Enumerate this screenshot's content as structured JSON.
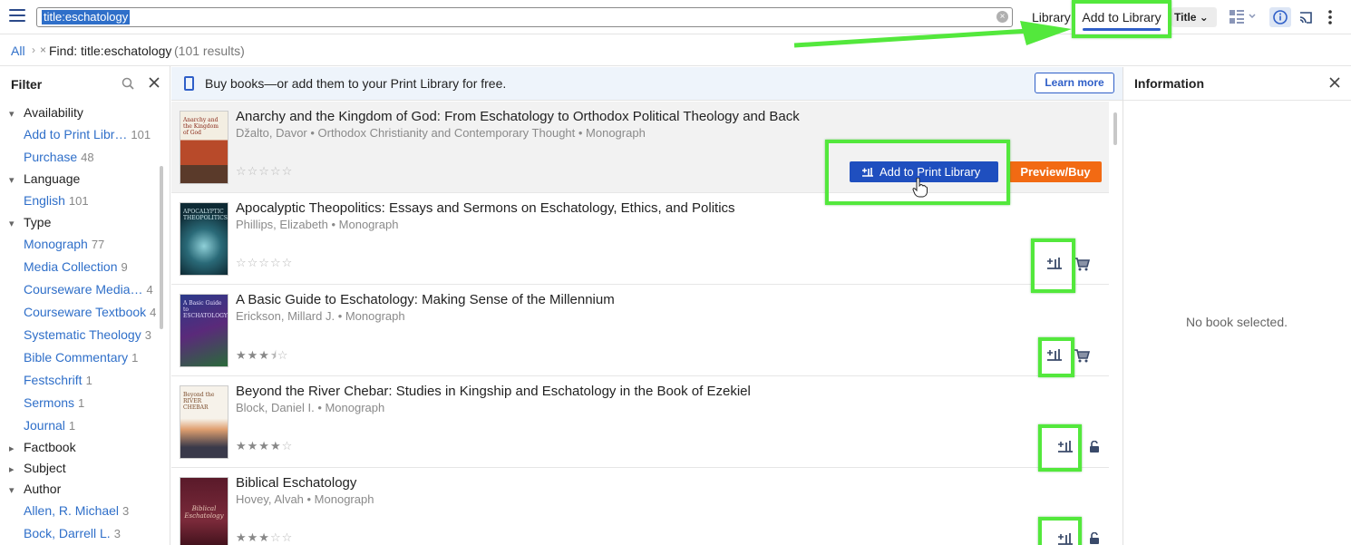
{
  "toolbar": {
    "search_query": "title:eschatology",
    "clear_symbol": "×",
    "tab_library": "Library",
    "tab_add_to_library": "Add to Library",
    "sort_label": "Title",
    "sort_chevron": "⌄"
  },
  "breadcrumb": {
    "all": "All",
    "separator": "›",
    "remove": "×",
    "find": "Find: title:eschatology",
    "count": "(101 results)"
  },
  "filter": {
    "title": "Filter",
    "groups": [
      {
        "label": "Availability",
        "expanded": true
      },
      {
        "label": "Language",
        "expanded": true
      },
      {
        "label": "Type",
        "expanded": true
      },
      {
        "label": "Factbook",
        "expanded": false
      },
      {
        "label": "Subject",
        "expanded": false
      },
      {
        "label": "Author",
        "expanded": true
      }
    ],
    "items": [
      {
        "label": "Add to Print Libr…",
        "count": "101"
      },
      {
        "label": "Purchase",
        "count": "48"
      },
      {
        "label": "English",
        "count": "101"
      },
      {
        "label": "Monograph",
        "count": "77"
      },
      {
        "label": "Media Collection",
        "count": "9"
      },
      {
        "label": "Courseware Media…",
        "count": "4"
      },
      {
        "label": "Courseware Textbook",
        "count": "4"
      },
      {
        "label": "Systematic Theology",
        "count": "3"
      },
      {
        "label": "Bible Commentary",
        "count": "1"
      },
      {
        "label": "Festschrift",
        "count": "1"
      },
      {
        "label": "Sermons",
        "count": "1"
      },
      {
        "label": "Journal",
        "count": "1"
      },
      {
        "label": "Allen, R. Michael",
        "count": "3"
      },
      {
        "label": "Bock, Darrell L.",
        "count": "3"
      }
    ]
  },
  "banner": {
    "message": "Buy books—or add them to your Print Library for free.",
    "learn_more": "Learn more"
  },
  "results": [
    {
      "title": "Anarchy and the Kingdom of God: From Eschatology to Orthodox Political Theology and Back",
      "meta": "Džalto, Davor • Orthodox Christianity and Contemporary Thought • Monograph",
      "rating": 0,
      "cover_text": "Anarchy and the Kingdom of God",
      "add_button": "Add to Print Library",
      "preview_button": "Preview/Buy"
    },
    {
      "title": "Apocalyptic Theopolitics: Essays and Sermons on Eschatology, Ethics, and Politics",
      "meta": "Phillips, Elizabeth • Monograph",
      "rating": 0,
      "cover_text": "APOCALYPTIC THEOPOLITICS"
    },
    {
      "title": "A Basic Guide to Eschatology: Making Sense of the Millennium",
      "meta": "Erickson, Millard J. • Monograph",
      "rating": 3.5,
      "cover_text": "A Basic Guide to ESCHATOLOGY"
    },
    {
      "title": "Beyond the River Chebar: Studies in Kingship and Eschatology in the Book of Ezekiel",
      "meta": "Block, Daniel I. • Monograph",
      "rating": 4,
      "cover_text": "Beyond the RIVER CHEBAR"
    },
    {
      "title": "Biblical Eschatology",
      "meta": "Hovey, Alvah • Monograph",
      "rating": 3,
      "cover_text": "Biblical Eschatology"
    }
  ],
  "info_panel": {
    "title": "Information",
    "empty": "No book selected."
  },
  "colors": {
    "accent_blue": "#2f6fc9",
    "add_button_blue": "#1f4fbf",
    "preview_orange": "#f26a13",
    "annotation_green": "#53e83c"
  }
}
